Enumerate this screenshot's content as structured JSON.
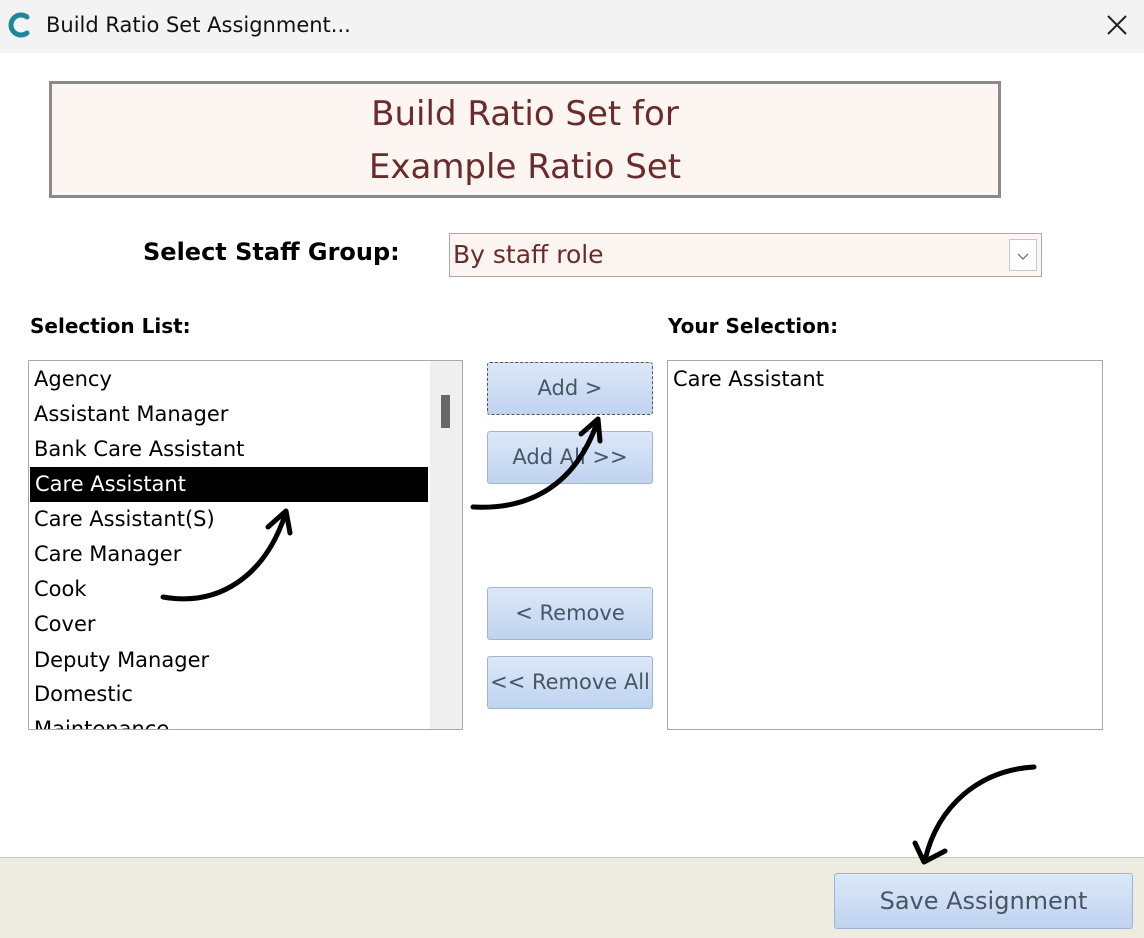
{
  "window": {
    "title": "Build Ratio Set Assignment...",
    "icon": "app-c-icon",
    "close_icon": "close-icon"
  },
  "header": {
    "line1": "Build Ratio Set for",
    "line2": "Example Ratio Set"
  },
  "staff_group": {
    "label": "Select Staff Group:",
    "value": "By staff role"
  },
  "selection_list": {
    "label": "Selection List:",
    "items": [
      "Agency",
      "Assistant Manager",
      "Bank Care Assistant",
      "Care Assistant",
      "Care Assistant(S)",
      "Care Manager",
      "Cook",
      "Cover",
      "Deputy Manager",
      "Domestic",
      "Maintenance"
    ],
    "selected": "Care Assistant"
  },
  "buttons": {
    "add": "Add >",
    "add_all": "Add All >>",
    "remove": "< Remove",
    "remove_all": "<< Remove All"
  },
  "your_selection": {
    "label": "Your Selection:",
    "items": [
      "Care Assistant"
    ]
  },
  "footer": {
    "save": "Save Assignment"
  },
  "colors": {
    "header_text": "#6b2b2b",
    "header_bg": "#fdf5f1",
    "button_bg": "#c9dbf4",
    "footer_bg": "#eeebe0",
    "app_icon": "#1a8a9a"
  }
}
